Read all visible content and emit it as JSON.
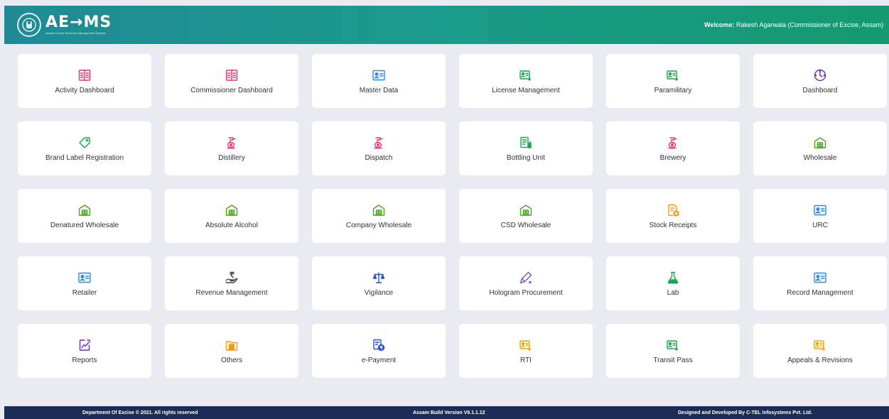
{
  "header": {
    "logo": "AE→MS",
    "tagline": "Assam Excise Revenue Management System",
    "welcome_prefix": "Welcome:",
    "welcome_user": "Rakesh Agarwala (Commissioner of Excise, Assam)"
  },
  "tiles": [
    {
      "label": "Activity Dashboard",
      "icon": "list-icon",
      "color": "#e8336f"
    },
    {
      "label": "Commissioner Dashboard",
      "icon": "list-icon",
      "color": "#e8336f"
    },
    {
      "label": "Master Data",
      "icon": "id-card-icon",
      "color": "#2b8ae6"
    },
    {
      "label": "License Management",
      "icon": "license-icon",
      "color": "#1aa84f"
    },
    {
      "label": "Paramilitary",
      "icon": "license-icon",
      "color": "#1aa84f"
    },
    {
      "label": "Dashboard",
      "icon": "clock-icon",
      "color": "#6a2fc6"
    },
    {
      "label": "Brand Label Registration",
      "icon": "tag-icon",
      "color": "#1aa84f"
    },
    {
      "label": "Distillery",
      "icon": "distillery-icon",
      "color": "#e8336f"
    },
    {
      "label": "Dispatch",
      "icon": "distillery-icon",
      "color": "#e8336f"
    },
    {
      "label": "Bottling Unit",
      "icon": "bottling-icon",
      "color": "#1aa84f"
    },
    {
      "label": "Brewery",
      "icon": "distillery-icon",
      "color": "#e8336f"
    },
    {
      "label": "Wholesale",
      "icon": "warehouse-icon",
      "color": "#4aa61c"
    },
    {
      "label": "Denatured Wholesale",
      "icon": "warehouse-icon",
      "color": "#4aa61c"
    },
    {
      "label": "Absolute Alcohol",
      "icon": "warehouse-icon",
      "color": "#4aa61c"
    },
    {
      "label": "Company Wholesale",
      "icon": "warehouse-icon",
      "color": "#4aa61c"
    },
    {
      "label": "CSD Wholesale",
      "icon": "warehouse-icon",
      "color": "#4aa61c"
    },
    {
      "label": "Stock Receipts",
      "icon": "receipt-icon",
      "color": "#f39c12"
    },
    {
      "label": "URC",
      "icon": "id-card-icon",
      "color": "#2b8ae6"
    },
    {
      "label": "Retailer",
      "icon": "id-card-icon",
      "color": "#2b8ae6"
    },
    {
      "label": "Revenue Management",
      "icon": "rupee-hand-icon",
      "color": "#444444"
    },
    {
      "label": "Vigilance",
      "icon": "scales-icon",
      "color": "#2a52c9"
    },
    {
      "label": "Hologram Procurement",
      "icon": "pen-icon",
      "color": "#7a4fbf"
    },
    {
      "label": "Lab",
      "icon": "flask-icon",
      "color": "#1aa84f"
    },
    {
      "label": "Record Management",
      "icon": "id-card-icon",
      "color": "#2b8ae6"
    },
    {
      "label": "Reports",
      "icon": "report-icon",
      "color": "#6a2fc6"
    },
    {
      "label": "Others",
      "icon": "folder-icon",
      "color": "#f39c12"
    },
    {
      "label": "e-Payment",
      "icon": "payment-icon",
      "color": "#2a52c9"
    },
    {
      "label": "RTI",
      "icon": "license-icon",
      "color": "#f0a500"
    },
    {
      "label": "Transit Pass",
      "icon": "license-icon",
      "color": "#1aa84f"
    },
    {
      "label": "Appeals & Revisions",
      "icon": "license-icon",
      "color": "#f0a500"
    }
  ],
  "footer": {
    "left": "Department Of Excise © 2021. All rights reserved",
    "center": "Assam Build Version V9.1.1.12",
    "right": "Designed and Developed By C-TEL Infosystems Pvt. Ltd."
  }
}
